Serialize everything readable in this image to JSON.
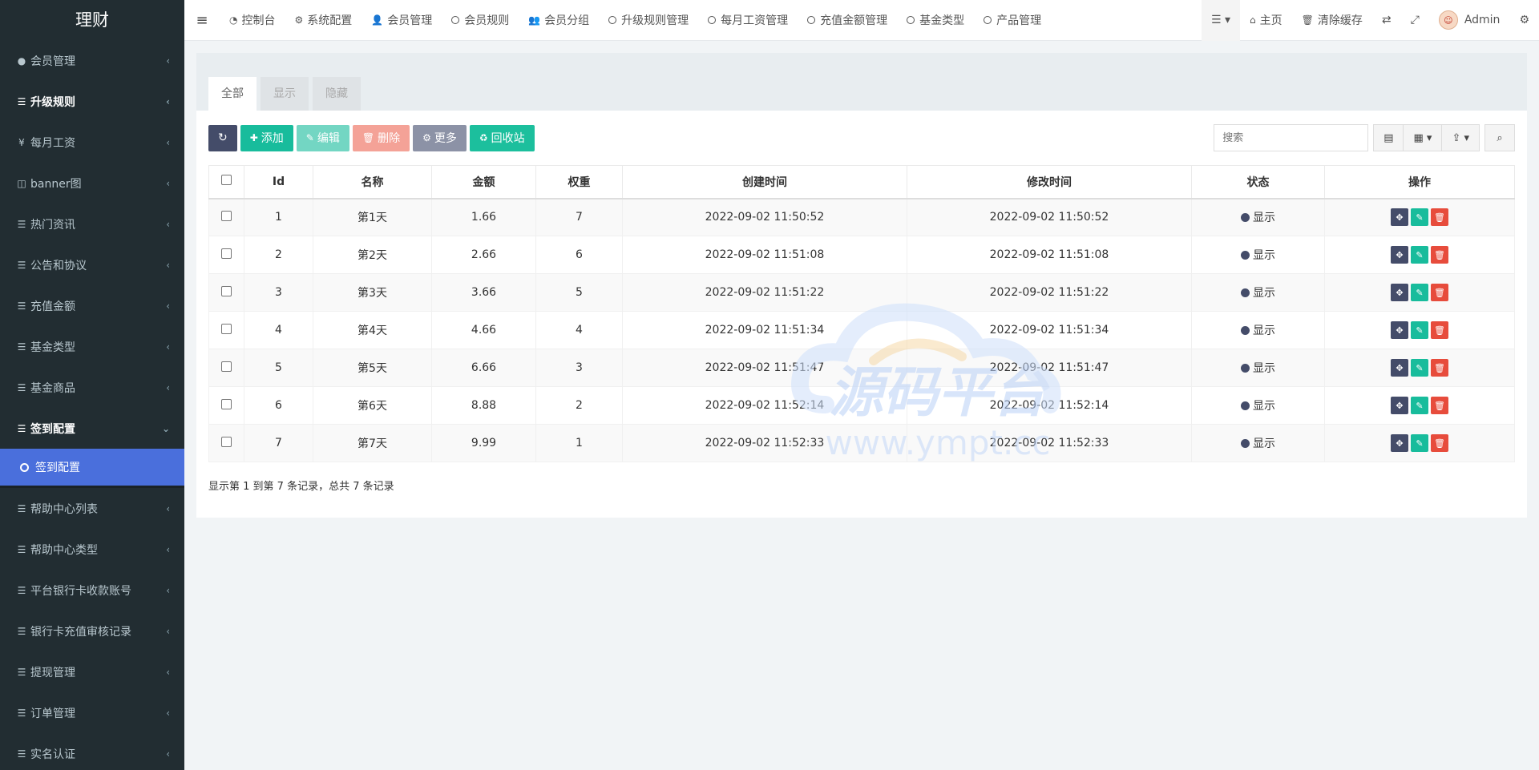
{
  "app": {
    "title": "理财"
  },
  "sidebar": {
    "items": [
      {
        "label": "会员管理",
        "icon": "user-circle-icon",
        "glyph": "●"
      },
      {
        "label": "升级规则",
        "icon": "list-icon",
        "glyph": "☰",
        "bold": true
      },
      {
        "label": "每月工资",
        "icon": "yen-icon",
        "glyph": "¥"
      },
      {
        "label": "banner图",
        "icon": "columns-icon",
        "glyph": "◫"
      },
      {
        "label": "热门资讯",
        "icon": "list-icon",
        "glyph": "☰"
      },
      {
        "label": "公告和协议",
        "icon": "list-icon",
        "glyph": "☰"
      },
      {
        "label": "充值金额",
        "icon": "list-icon",
        "glyph": "☰"
      },
      {
        "label": "基金类型",
        "icon": "list-icon",
        "glyph": "☰"
      },
      {
        "label": "基金商品",
        "icon": "list-icon",
        "glyph": "☰"
      }
    ],
    "open_item": {
      "label": "签到配置",
      "icon": "list-icon",
      "glyph": "☰"
    },
    "open_sub": {
      "label": "签到配置"
    },
    "items_after": [
      {
        "label": "帮助中心列表",
        "icon": "list-icon",
        "glyph": "☰"
      },
      {
        "label": "帮助中心类型",
        "icon": "list-icon",
        "glyph": "☰"
      },
      {
        "label": "平台银行卡收款账号",
        "icon": "list-icon",
        "glyph": "☰"
      },
      {
        "label": "银行卡充值审核记录",
        "icon": "list-icon",
        "glyph": "☰"
      },
      {
        "label": "提现管理",
        "icon": "list-icon",
        "glyph": "☰"
      },
      {
        "label": "订单管理",
        "icon": "list-icon",
        "glyph": "☰"
      },
      {
        "label": "实名认证",
        "icon": "list-icon",
        "glyph": "☰"
      }
    ]
  },
  "topbar": {
    "nav": [
      {
        "label": "控制台",
        "icon": "dashboard-icon"
      },
      {
        "label": "系统配置",
        "icon": "gear-icon"
      },
      {
        "label": "会员管理",
        "icon": "user-icon"
      },
      {
        "label": "会员规则",
        "icon": "circle-icon"
      },
      {
        "label": "会员分组",
        "icon": "users-icon"
      },
      {
        "label": "升级规则管理",
        "icon": "circle-icon"
      },
      {
        "label": "每月工资管理",
        "icon": "circle-icon"
      },
      {
        "label": "充值金额管理",
        "icon": "circle-icon"
      },
      {
        "label": "基金类型",
        "icon": "circle-icon"
      },
      {
        "label": "产品管理",
        "icon": "circle-icon"
      }
    ],
    "home": "主页",
    "clear_cache": "清除缓存",
    "user": "Admin"
  },
  "tabs": [
    "全部",
    "显示",
    "隐藏"
  ],
  "toolbar": {
    "add": "添加",
    "edit": "编辑",
    "delete": "删除",
    "more": "更多",
    "recycle": "回收站",
    "search_placeholder": "搜索"
  },
  "table": {
    "headers": [
      "Id",
      "名称",
      "金额",
      "权重",
      "创建时间",
      "修改时间",
      "状态",
      "操作"
    ],
    "rows": [
      {
        "id": "1",
        "name": "第1天",
        "amount": "1.66",
        "weight": "7",
        "created": "2022-09-02 11:50:52",
        "updated": "2022-09-02 11:50:52",
        "status": "显示"
      },
      {
        "id": "2",
        "name": "第2天",
        "amount": "2.66",
        "weight": "6",
        "created": "2022-09-02 11:51:08",
        "updated": "2022-09-02 11:51:08",
        "status": "显示"
      },
      {
        "id": "3",
        "name": "第3天",
        "amount": "3.66",
        "weight": "5",
        "created": "2022-09-02 11:51:22",
        "updated": "2022-09-02 11:51:22",
        "status": "显示"
      },
      {
        "id": "4",
        "name": "第4天",
        "amount": "4.66",
        "weight": "4",
        "created": "2022-09-02 11:51:34",
        "updated": "2022-09-02 11:51:34",
        "status": "显示"
      },
      {
        "id": "5",
        "name": "第5天",
        "amount": "6.66",
        "weight": "3",
        "created": "2022-09-02 11:51:47",
        "updated": "2022-09-02 11:51:47",
        "status": "显示"
      },
      {
        "id": "6",
        "name": "第6天",
        "amount": "8.88",
        "weight": "2",
        "created": "2022-09-02 11:52:14",
        "updated": "2022-09-02 11:52:14",
        "status": "显示"
      },
      {
        "id": "7",
        "name": "第7天",
        "amount": "9.99",
        "weight": "1",
        "created": "2022-09-02 11:52:33",
        "updated": "2022-09-02 11:52:33",
        "status": "显示"
      }
    ]
  },
  "pager": {
    "info": "显示第 1 到第 7 条记录，总共 7 条记录"
  },
  "watermark": {
    "text": "源码平台",
    "url": "www.ympt.cc"
  },
  "colors": {
    "sidebar_bg": "#222d32",
    "active_sub": "#4a6fdc",
    "primary_dark": "#444c69",
    "success": "#18bc9c",
    "danger": "#e74c3c"
  }
}
